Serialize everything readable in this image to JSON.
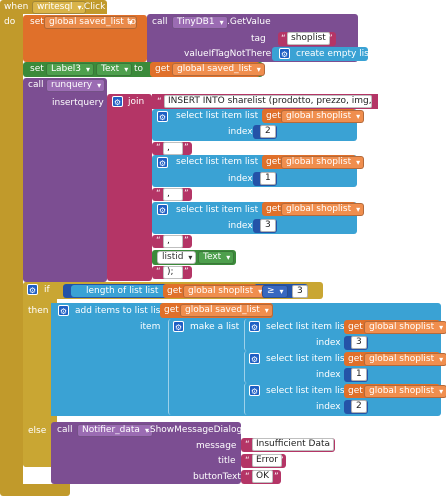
{
  "event": {
    "when": "when",
    "component": "writesql",
    "event_name": ".Click",
    "do": "do"
  },
  "block1": {
    "set": "set",
    "var": "global saved_list",
    "to": "to",
    "call": "call",
    "component": "TinyDB1",
    "method": ".GetValue",
    "tag_label": "tag",
    "tag_value": "shoplist",
    "vitn_label": "valueIfTagNotThere",
    "vitn_value": "create empty list"
  },
  "block2": {
    "set": "set",
    "component": "Label3",
    "prop": "Text",
    "to": "to",
    "get": "get",
    "var": "global saved_list"
  },
  "block3": {
    "call": "call",
    "method": "runquery",
    "param": "insertquery",
    "join": "join",
    "sql": "INSERT INTO sharelist (prodotto, prezzo, img, li...",
    "select_label": "select list item  list",
    "index_label": "index",
    "get": "get",
    "var": "global shoplist",
    "quote": "\" , \"",
    "quote_end": "\" );\"",
    "indices": [
      "2",
      "1",
      "3"
    ],
    "listid": "listid",
    "text": "Text"
  },
  "ifblock": {
    "if": "if",
    "then": "then",
    "else": "else",
    "length_label": "length of list  list",
    "get": "get",
    "var": "global shoplist",
    "op": "≥",
    "num": "3"
  },
  "addblock": {
    "label": "add items to list  list",
    "get": "get",
    "var": "global saved_list",
    "item": "item",
    "make": "make a list",
    "select_label": "select list item  list",
    "index_label": "index",
    "var2": "global shoplist",
    "indices": [
      "3",
      "1",
      "2"
    ]
  },
  "elseblock": {
    "call": "call",
    "component": "Notifier_data",
    "method": ".ShowMessageDialog",
    "message_label": "message",
    "message": "Insufficient Data",
    "title_label": "title",
    "title": "Error",
    "button_label": "buttonText",
    "button": "OK"
  },
  "colors": {
    "event": "#c19a2b",
    "variable": "#e0702a",
    "component_green": "#3b8a3a",
    "procedure": "#7c4e92",
    "text": "#b43566",
    "list": "#3aa2d4",
    "control": "#c9a633",
    "math": "#2453a8"
  }
}
